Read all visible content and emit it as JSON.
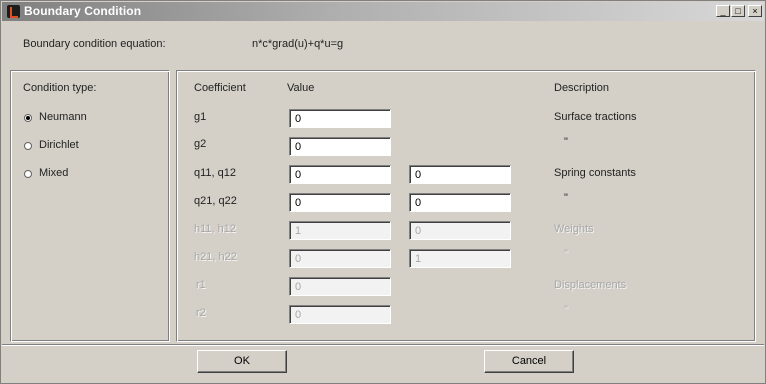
{
  "window": {
    "title": "Boundary Condition",
    "controls": [
      "_",
      "□",
      "×"
    ]
  },
  "equation": {
    "label": "Boundary condition equation:",
    "value": "n*c*grad(u)+q*u=g"
  },
  "condition_type": {
    "heading": "Condition type:",
    "options": [
      {
        "label": "Neumann",
        "selected": true
      },
      {
        "label": "Dirichlet",
        "selected": false
      },
      {
        "label": "Mixed",
        "selected": false
      }
    ]
  },
  "table": {
    "headers": {
      "coefficient": "Coefficient",
      "value": "Value",
      "description": "Description"
    },
    "rows": [
      {
        "coef": "g1",
        "v1": "0",
        "v2": null,
        "enabled": true
      },
      {
        "coef": "g2",
        "v1": "0",
        "v2": null,
        "enabled": true
      },
      {
        "coef": "q11, q12",
        "v1": "0",
        "v2": "0",
        "enabled": true
      },
      {
        "coef": "q21, q22",
        "v1": "0",
        "v2": "0",
        "enabled": true
      },
      {
        "coef": "h11, h12",
        "v1": "1",
        "v2": "0",
        "enabled": false
      },
      {
        "coef": "h21, h22",
        "v1": "0",
        "v2": "1",
        "enabled": false
      },
      {
        "coef": "r1",
        "v1": "0",
        "v2": null,
        "enabled": false
      },
      {
        "coef": "r2",
        "v1": "0",
        "v2": null,
        "enabled": false
      }
    ],
    "descriptions": [
      {
        "text": "Surface tractions",
        "enabled": true
      },
      {
        "text": "\"",
        "enabled": true
      },
      {
        "text": "Spring constants",
        "enabled": true
      },
      {
        "text": "\"",
        "enabled": true
      },
      {
        "text": "Weights",
        "enabled": false
      },
      {
        "text": "\"",
        "enabled": false
      },
      {
        "text": "Displacements",
        "enabled": false
      },
      {
        "text": "\"",
        "enabled": false
      }
    ]
  },
  "buttons": {
    "ok": "OK",
    "cancel": "Cancel"
  }
}
